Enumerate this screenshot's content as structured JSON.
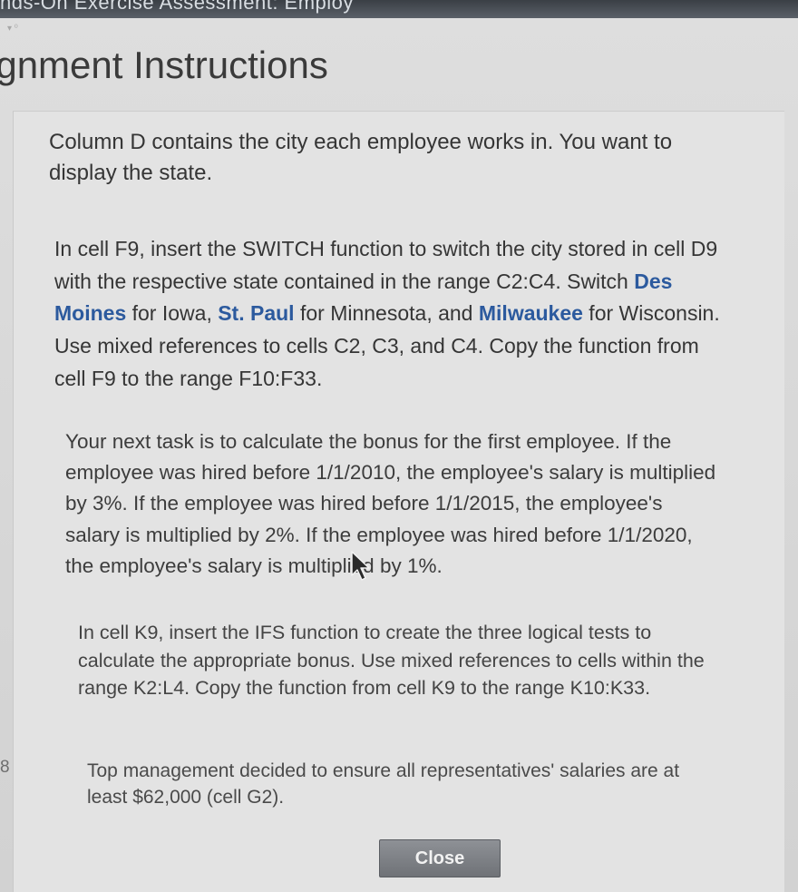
{
  "window": {
    "title_fragment": "nds-On Exercise Assessment: Employ"
  },
  "header": {
    "title": "ignment Instructions"
  },
  "instructions": {
    "step_intro": "Column D contains the city each employee works in. You want to display the state.",
    "switch_step": {
      "part1": "In cell F9, insert the SWITCH function to switch the city stored in cell D9 with the respective state contained in the range C2:C4. Switch ",
      "city1": "Des Moines",
      "part2": " for Iowa, ",
      "city2": "St. Paul",
      "part3": " for Minnesota, and ",
      "city3": "Milwaukee",
      "part4": " for Wisconsin. Use mixed references to cells C2, C3, and C4. Copy the function from cell F9 to the range F10:F33."
    },
    "bonus_intro": "Your next task is to calculate the bonus for the first employee. If the employee was hired before 1/1/2010, the employee's salary is multiplied by 3%. If the employee was hired before 1/1/2015, the employee's salary is multiplied by 2%. If the employee was hired before 1/1/2020, the employee's salary is multiplied by 1%.",
    "ifs_step": "In cell K9, insert the IFS function to create the three logical tests to calculate the appropriate bonus. Use mixed references to cells within the range K2:L4. Copy the function from cell K9 to the range K10:K33.",
    "step8_number": "8",
    "step8_text": "Top management decided to ensure all representatives' salaries are at least $62,000 (cell G2)."
  },
  "footer": {
    "close_label": "Close"
  },
  "icons": {
    "cursor": "mouse-pointer-icon"
  }
}
